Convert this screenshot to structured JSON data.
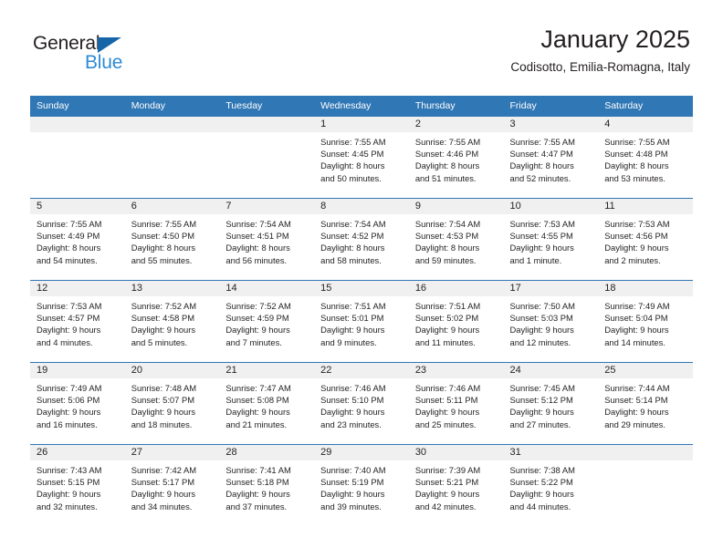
{
  "brand": {
    "name_top": "General",
    "name_bottom": "Blue",
    "triangle_color": "#1565a8",
    "blue_color": "#2e8ad4",
    "dark_color": "#231f20"
  },
  "header": {
    "title": "January 2025",
    "subtitle": "Codisotto, Emilia-Romagna, Italy"
  },
  "theme": {
    "header_row_bg": "#3077b5",
    "header_row_text": "#ffffff",
    "daynum_band_bg": "#f0f0f0",
    "cell_bg": "#ffffff",
    "grid_line": "#3077b5",
    "text": "#231f20"
  },
  "calendar": {
    "weekday_headers": [
      "Sunday",
      "Monday",
      "Tuesday",
      "Wednesday",
      "Thursday",
      "Friday",
      "Saturday"
    ],
    "weeks": [
      [
        {
          "day": "",
          "lines": []
        },
        {
          "day": "",
          "lines": []
        },
        {
          "day": "",
          "lines": []
        },
        {
          "day": "1",
          "lines": [
            "Sunrise: 7:55 AM",
            "Sunset: 4:45 PM",
            "Daylight: 8 hours",
            "and 50 minutes."
          ]
        },
        {
          "day": "2",
          "lines": [
            "Sunrise: 7:55 AM",
            "Sunset: 4:46 PM",
            "Daylight: 8 hours",
            "and 51 minutes."
          ]
        },
        {
          "day": "3",
          "lines": [
            "Sunrise: 7:55 AM",
            "Sunset: 4:47 PM",
            "Daylight: 8 hours",
            "and 52 minutes."
          ]
        },
        {
          "day": "4",
          "lines": [
            "Sunrise: 7:55 AM",
            "Sunset: 4:48 PM",
            "Daylight: 8 hours",
            "and 53 minutes."
          ]
        }
      ],
      [
        {
          "day": "5",
          "lines": [
            "Sunrise: 7:55 AM",
            "Sunset: 4:49 PM",
            "Daylight: 8 hours",
            "and 54 minutes."
          ]
        },
        {
          "day": "6",
          "lines": [
            "Sunrise: 7:55 AM",
            "Sunset: 4:50 PM",
            "Daylight: 8 hours",
            "and 55 minutes."
          ]
        },
        {
          "day": "7",
          "lines": [
            "Sunrise: 7:54 AM",
            "Sunset: 4:51 PM",
            "Daylight: 8 hours",
            "and 56 minutes."
          ]
        },
        {
          "day": "8",
          "lines": [
            "Sunrise: 7:54 AM",
            "Sunset: 4:52 PM",
            "Daylight: 8 hours",
            "and 58 minutes."
          ]
        },
        {
          "day": "9",
          "lines": [
            "Sunrise: 7:54 AM",
            "Sunset: 4:53 PM",
            "Daylight: 8 hours",
            "and 59 minutes."
          ]
        },
        {
          "day": "10",
          "lines": [
            "Sunrise: 7:53 AM",
            "Sunset: 4:55 PM",
            "Daylight: 9 hours",
            "and 1 minute."
          ]
        },
        {
          "day": "11",
          "lines": [
            "Sunrise: 7:53 AM",
            "Sunset: 4:56 PM",
            "Daylight: 9 hours",
            "and 2 minutes."
          ]
        }
      ],
      [
        {
          "day": "12",
          "lines": [
            "Sunrise: 7:53 AM",
            "Sunset: 4:57 PM",
            "Daylight: 9 hours",
            "and 4 minutes."
          ]
        },
        {
          "day": "13",
          "lines": [
            "Sunrise: 7:52 AM",
            "Sunset: 4:58 PM",
            "Daylight: 9 hours",
            "and 5 minutes."
          ]
        },
        {
          "day": "14",
          "lines": [
            "Sunrise: 7:52 AM",
            "Sunset: 4:59 PM",
            "Daylight: 9 hours",
            "and 7 minutes."
          ]
        },
        {
          "day": "15",
          "lines": [
            "Sunrise: 7:51 AM",
            "Sunset: 5:01 PM",
            "Daylight: 9 hours",
            "and 9 minutes."
          ]
        },
        {
          "day": "16",
          "lines": [
            "Sunrise: 7:51 AM",
            "Sunset: 5:02 PM",
            "Daylight: 9 hours",
            "and 11 minutes."
          ]
        },
        {
          "day": "17",
          "lines": [
            "Sunrise: 7:50 AM",
            "Sunset: 5:03 PM",
            "Daylight: 9 hours",
            "and 12 minutes."
          ]
        },
        {
          "day": "18",
          "lines": [
            "Sunrise: 7:49 AM",
            "Sunset: 5:04 PM",
            "Daylight: 9 hours",
            "and 14 minutes."
          ]
        }
      ],
      [
        {
          "day": "19",
          "lines": [
            "Sunrise: 7:49 AM",
            "Sunset: 5:06 PM",
            "Daylight: 9 hours",
            "and 16 minutes."
          ]
        },
        {
          "day": "20",
          "lines": [
            "Sunrise: 7:48 AM",
            "Sunset: 5:07 PM",
            "Daylight: 9 hours",
            "and 18 minutes."
          ]
        },
        {
          "day": "21",
          "lines": [
            "Sunrise: 7:47 AM",
            "Sunset: 5:08 PM",
            "Daylight: 9 hours",
            "and 21 minutes."
          ]
        },
        {
          "day": "22",
          "lines": [
            "Sunrise: 7:46 AM",
            "Sunset: 5:10 PM",
            "Daylight: 9 hours",
            "and 23 minutes."
          ]
        },
        {
          "day": "23",
          "lines": [
            "Sunrise: 7:46 AM",
            "Sunset: 5:11 PM",
            "Daylight: 9 hours",
            "and 25 minutes."
          ]
        },
        {
          "day": "24",
          "lines": [
            "Sunrise: 7:45 AM",
            "Sunset: 5:12 PM",
            "Daylight: 9 hours",
            "and 27 minutes."
          ]
        },
        {
          "day": "25",
          "lines": [
            "Sunrise: 7:44 AM",
            "Sunset: 5:14 PM",
            "Daylight: 9 hours",
            "and 29 minutes."
          ]
        }
      ],
      [
        {
          "day": "26",
          "lines": [
            "Sunrise: 7:43 AM",
            "Sunset: 5:15 PM",
            "Daylight: 9 hours",
            "and 32 minutes."
          ]
        },
        {
          "day": "27",
          "lines": [
            "Sunrise: 7:42 AM",
            "Sunset: 5:17 PM",
            "Daylight: 9 hours",
            "and 34 minutes."
          ]
        },
        {
          "day": "28",
          "lines": [
            "Sunrise: 7:41 AM",
            "Sunset: 5:18 PM",
            "Daylight: 9 hours",
            "and 37 minutes."
          ]
        },
        {
          "day": "29",
          "lines": [
            "Sunrise: 7:40 AM",
            "Sunset: 5:19 PM",
            "Daylight: 9 hours",
            "and 39 minutes."
          ]
        },
        {
          "day": "30",
          "lines": [
            "Sunrise: 7:39 AM",
            "Sunset: 5:21 PM",
            "Daylight: 9 hours",
            "and 42 minutes."
          ]
        },
        {
          "day": "31",
          "lines": [
            "Sunrise: 7:38 AM",
            "Sunset: 5:22 PM",
            "Daylight: 9 hours",
            "and 44 minutes."
          ]
        },
        {
          "day": "",
          "lines": []
        }
      ]
    ]
  }
}
